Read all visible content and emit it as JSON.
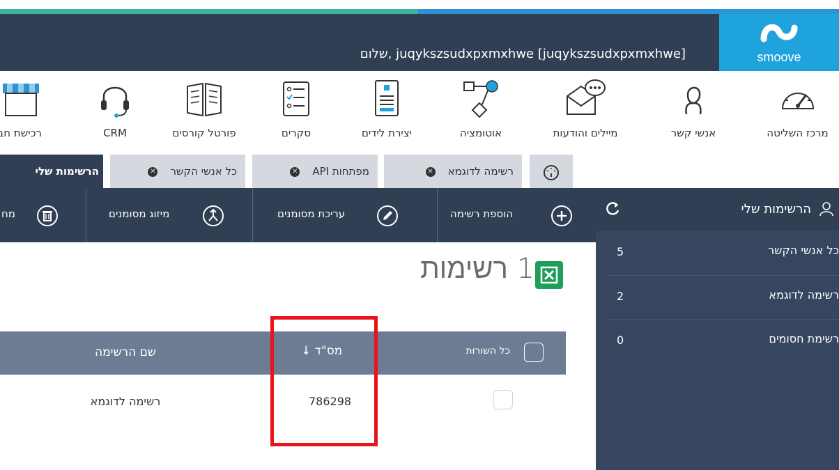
{
  "header": {
    "greeting": "[juqykszsudxpxmxhwe] juqykszsudxpxmxhwe ,שלום",
    "logo_text": "smoove"
  },
  "toolbar": {
    "items": [
      {
        "label": "מרכז השליטה",
        "icon": "dashboard-icon"
      },
      {
        "label": "אנשי קשר",
        "icon": "contact-person-icon"
      },
      {
        "label": "מיילים והודעות",
        "icon": "mail-messages-icon"
      },
      {
        "label": "אוטומציה",
        "icon": "automation-flow-icon"
      },
      {
        "label": "יצירת לידים",
        "icon": "lead-form-icon"
      },
      {
        "label": "סקרים",
        "icon": "survey-checklist-icon"
      },
      {
        "label": "פורטל קורסים",
        "icon": "open-book-icon"
      },
      {
        "label": "CRM",
        "icon": "headset-icon"
      },
      {
        "label": "רכישת חב",
        "icon": "store-awning-icon"
      }
    ]
  },
  "tabs": {
    "items": [
      {
        "label": "",
        "icon": "gauge-icon"
      },
      {
        "label": "רשימה לדוגמא"
      },
      {
        "label": "מפתחות API"
      },
      {
        "label": "כל אנשי הקשר"
      },
      {
        "label": "הרשימות שלי",
        "active": true
      }
    ]
  },
  "sidebar": {
    "title": "הרשימות שלי",
    "lists": [
      {
        "name": "כל אנשי הקשר",
        "count": "5"
      },
      {
        "name": "רשימה לדוגמא",
        "count": "2"
      },
      {
        "name": "רשימת חסומים",
        "count": "0"
      }
    ]
  },
  "actions": {
    "add_list": "הוספת רשימה",
    "edit_selected": "עריכת מסומנים",
    "merge_selected": "מיזוג מסומנים",
    "delete_partial": "מח"
  },
  "main": {
    "title": "1 רשימות",
    "table": {
      "col_select_all": "כל השורות",
      "col_id": "מס\"ד ↓",
      "col_name": "שם הרשימה",
      "rows": [
        {
          "id": "786298",
          "name": "רשימה לדוגמא"
        }
      ]
    }
  },
  "colors": {
    "header_bg": "#313f55",
    "logo_bg": "#1fa3dc",
    "sidebar_bg": "#36465e",
    "table_head_bg": "#6e7c93",
    "highlight": "#e8141b",
    "excel_green": "#1e9e5a"
  }
}
